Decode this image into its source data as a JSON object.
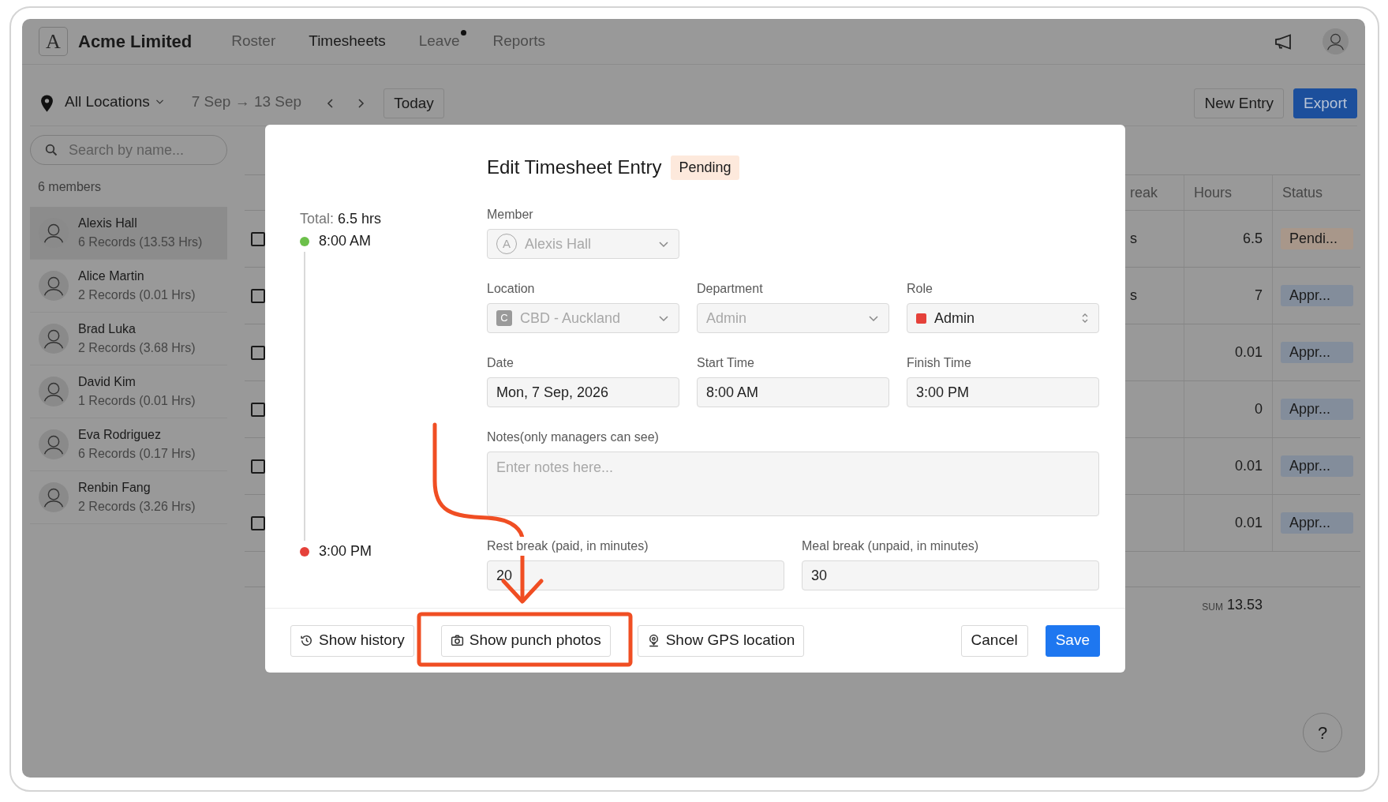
{
  "app": {
    "logo_text": "A",
    "name": "Acme Limited"
  },
  "nav": [
    {
      "label": "Roster",
      "selected": false,
      "dot": false
    },
    {
      "label": "Timesheets",
      "selected": true,
      "dot": false
    },
    {
      "label": "Leave",
      "selected": false,
      "dot": true
    },
    {
      "label": "Reports",
      "selected": false,
      "dot": false
    }
  ],
  "toolbar": {
    "location": "All Locations",
    "date_range": "7 Sep → 13 Sep",
    "today": "Today",
    "buttons": [
      {
        "label": "New Entry",
        "kind": "secondary"
      },
      {
        "label": "Export",
        "kind": "primary"
      }
    ]
  },
  "sidebar": {
    "search_placeholder": "Search by name...",
    "count": "6 members",
    "members": [
      {
        "name": "Alexis Hall",
        "summary": "6 Records (13.53 Hrs)",
        "selected": true
      },
      {
        "name": "Alice Martin",
        "summary": "2 Records (0.01 Hrs)",
        "selected": false
      },
      {
        "name": "Brad Luka",
        "summary": "2 Records (3.68 Hrs)",
        "selected": false
      },
      {
        "name": "David Kim",
        "summary": "1 Records (0.01 Hrs)",
        "selected": false
      },
      {
        "name": "Eva Rodriguez",
        "summary": "6 Records (0.17 Hrs)",
        "selected": false
      },
      {
        "name": "Renbin Fang",
        "summary": "2 Records (3.26 Hrs)",
        "selected": false
      }
    ]
  },
  "table": {
    "columns": [
      "reak",
      "Hours",
      "Status"
    ],
    "rows": [
      {
        "checked": false,
        "column_1": "s",
        "hours": "6.5",
        "status": "Pendi...",
        "kind": "pending"
      },
      {
        "checked": false,
        "column_1": "s",
        "hours": "7",
        "status": "Appr...",
        "kind": "approved"
      },
      {
        "checked": false,
        "hours": "0.01",
        "status": "Appr...",
        "kind": "approved"
      },
      {
        "checked": false,
        "hours": "0",
        "status": "Appr...",
        "kind": "approved"
      },
      {
        "checked": false,
        "hours": "0.01",
        "status": "Appr...",
        "kind": "approved"
      },
      {
        "checked": false,
        "hours": "0.01",
        "status": "Appr...",
        "kind": "approved"
      }
    ],
    "sum_label": "SUM",
    "sum": "13.53"
  },
  "modal": {
    "title": "Edit Timesheet Entry",
    "badge": "Pending",
    "total_label": "Total:",
    "total": "6.5 hrs",
    "start": "8:00 AM",
    "finish": "3:00 PM",
    "member": {
      "label": "Member",
      "value": "Alexis Hall",
      "avatar": "A",
      "disabled": true
    },
    "fields": [
      {
        "label": "Location",
        "value": "CBD - Auckland",
        "kind": "badge-select",
        "badge": "C",
        "disabled": true
      },
      {
        "label": "Department",
        "value": "Admin",
        "kind": "select",
        "disabled": true
      },
      {
        "label": "Role",
        "value": "Admin",
        "kind": "color-select",
        "color": "#e5413a",
        "disabled": false
      },
      {
        "label": "Date",
        "value": "Mon, 7 Sep, 2026",
        "kind": "text",
        "disabled": false
      },
      {
        "label": "Start Time",
        "value": "8:00 AM",
        "kind": "text",
        "disabled": false
      },
      {
        "label": "Finish Time",
        "value": "3:00 PM",
        "kind": "text",
        "disabled": false
      }
    ],
    "notes": {
      "label": "Notes(only managers can see)",
      "placeholder": "Enter notes here..."
    },
    "breaks": [
      {
        "label": "Rest break (paid, in minutes)",
        "value": "20"
      },
      {
        "label": "Meal break (unpaid, in minutes)",
        "value": "30"
      }
    ],
    "footer_buttons": [
      {
        "label": "Show history",
        "kind": "history"
      },
      {
        "label": "Show punch photos",
        "kind": "photos"
      },
      {
        "label": "Show GPS location",
        "kind": "location"
      }
    ],
    "actions": [
      {
        "label": "Cancel",
        "kind": "secondary"
      },
      {
        "label": "Save",
        "kind": "primary"
      }
    ]
  },
  "help": "?"
}
